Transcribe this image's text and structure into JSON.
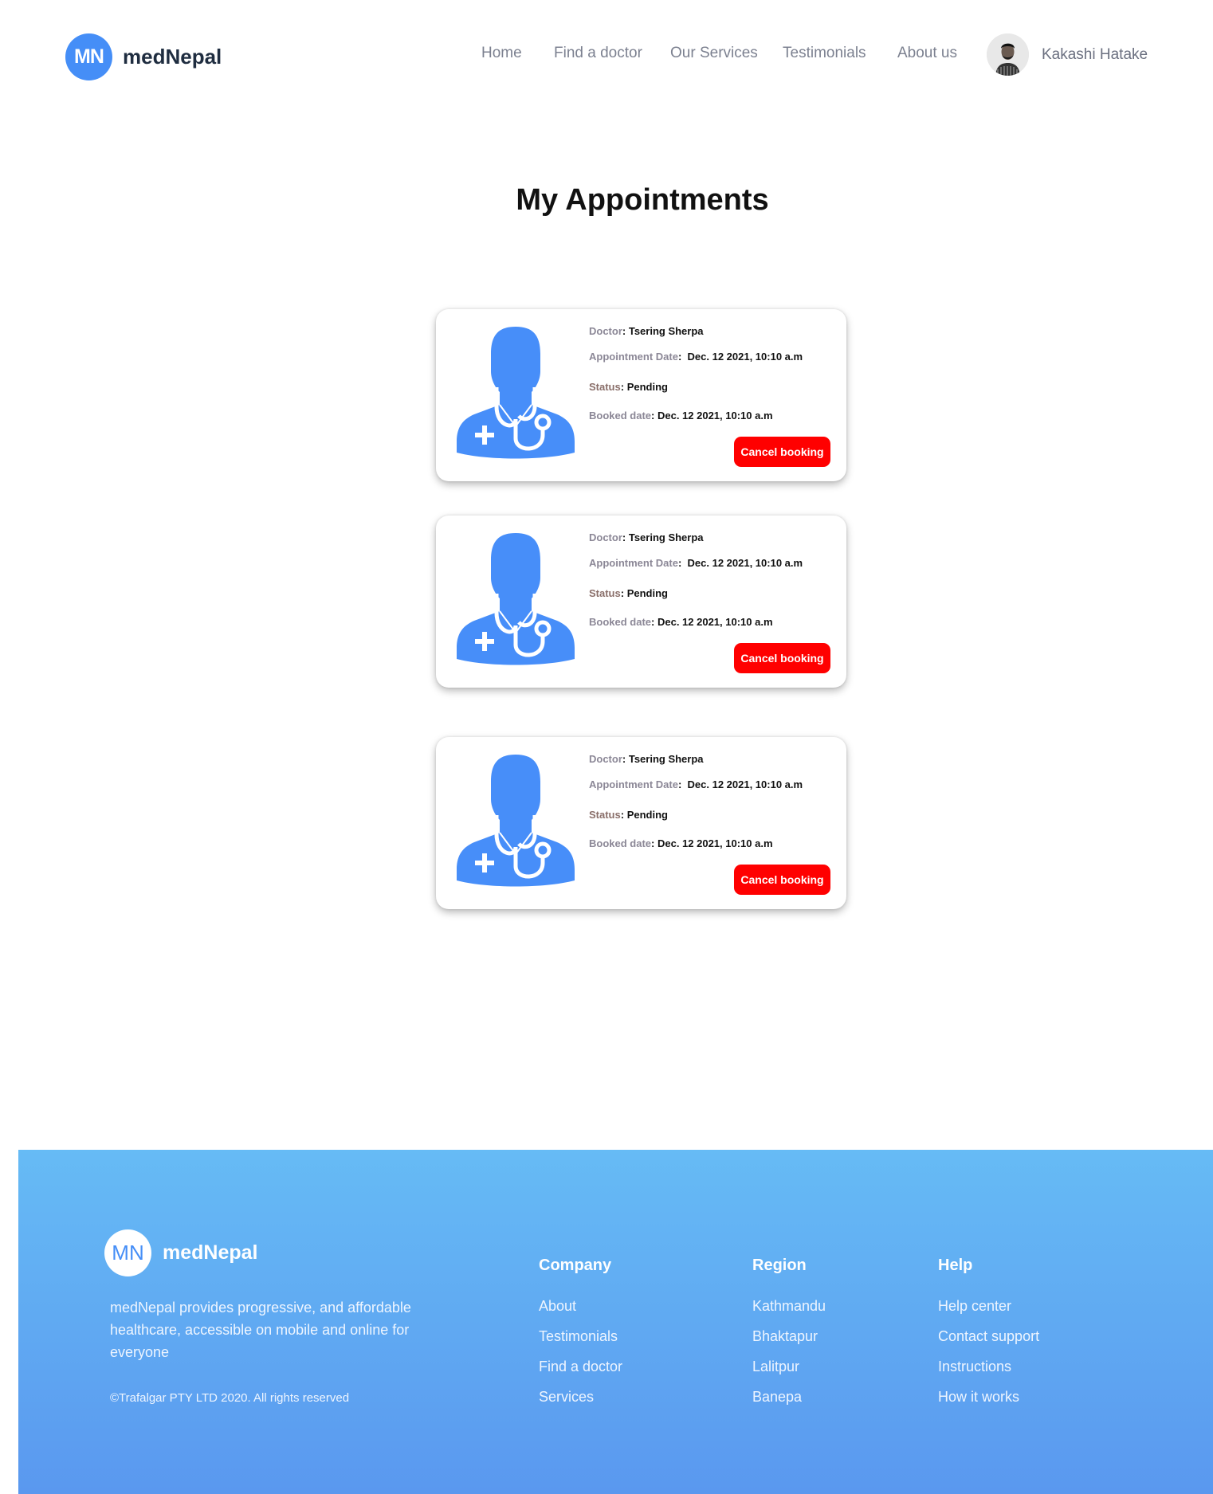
{
  "header": {
    "logo_mark": "MN",
    "logo_text": "medNepal",
    "nav": [
      "Home",
      "Find a doctor",
      "Our Services",
      "Testimonials",
      "About us"
    ],
    "user_name": "Kakashi Hatake"
  },
  "page_title": "My Appointments",
  "appointments": [
    {
      "doctor_label": "Doctor",
      "doctor": "Tsering Sherpa",
      "date_label": "Appointment Date",
      "date": "Dec. 12 2021, 10:10 a.m",
      "status_label": "Status",
      "status": "Pending",
      "booked_label": "Booked date",
      "booked": "Dec. 12 2021, 10:10 a.m",
      "cancel_label": "Cancel booking"
    },
    {
      "doctor_label": "Doctor",
      "doctor": "Tsering Sherpa",
      "date_label": "Appointment Date",
      "date": "Dec. 12 2021, 10:10 a.m",
      "status_label": "Status",
      "status": "Pending",
      "booked_label": "Booked date",
      "booked": "Dec. 12 2021, 10:10 a.m",
      "cancel_label": "Cancel booking"
    },
    {
      "doctor_label": "Doctor",
      "doctor": "Tsering Sherpa",
      "date_label": "Appointment Date",
      "date": "Dec. 12 2021, 10:10 a.m",
      "status_label": "Status",
      "status": "Pending",
      "booked_label": "Booked date",
      "booked": "Dec. 12 2021, 10:10 a.m",
      "cancel_label": "Cancel booking"
    }
  ],
  "footer": {
    "logo_mark": "MN",
    "logo_text": "medNepal",
    "description": "medNepal provides progressive, and affordable healthcare, accessible on mobile and online for everyone",
    "copyright": "©Trafalgar PTY LTD 2020. All rights reserved",
    "columns": [
      {
        "title": "Company",
        "links": [
          "About",
          "Testimonials",
          "Find a doctor",
          "Services"
        ]
      },
      {
        "title": "Region",
        "links": [
          "Kathmandu",
          "Bhaktapur",
          "Lalitpur",
          "Banepa"
        ]
      },
      {
        "title": "Help",
        "links": [
          "Help center",
          "Contact support",
          "Instructions",
          "How it works"
        ]
      }
    ]
  },
  "colors": {
    "brand": "#458ef7",
    "doctor_icon": "#478ef9",
    "cancel": "#ff0000",
    "footer_top": "#66bbf5",
    "footer_bottom": "#5a98ef"
  },
  "icons": {
    "logo": "mn-logo-icon",
    "avatar": "user-avatar-icon",
    "doctor": "doctor-stethoscope-icon"
  }
}
